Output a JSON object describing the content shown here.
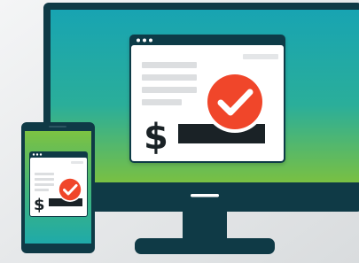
{
  "illustration": {
    "currency_symbol": "$",
    "colors": {
      "background_top": "#f4f5f6",
      "background_bottom": "#d9dcde",
      "device_frame": "#0f3a46",
      "screen_teal": "#1faaa9",
      "screen_green": "#7cc242",
      "window_body": "#ffffff",
      "window_border": "#e1e3e5",
      "text_line": "#dcdee0",
      "check_circle": "#f0462a",
      "check_mark": "#ffffff",
      "dark_bar": "#1a2226"
    },
    "icons": [
      "dollar-icon",
      "checkmark-circle-icon",
      "window-dots-icon"
    ]
  }
}
